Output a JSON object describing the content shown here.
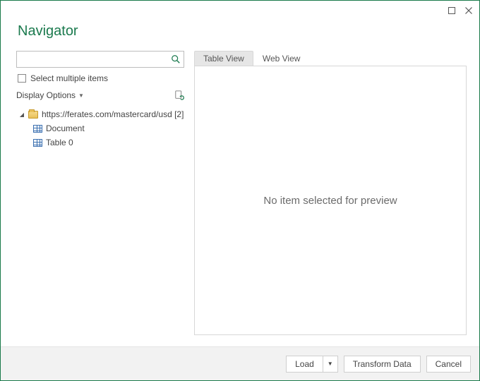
{
  "titlebar": {
    "maximize_icon": "maximize",
    "close_icon": "close"
  },
  "header": {
    "title": "Navigator"
  },
  "search": {
    "placeholder": ""
  },
  "checkbox": {
    "label": "Select multiple items"
  },
  "display_options": {
    "label": "Display Options"
  },
  "tree": {
    "root": {
      "label": "https://ferates.com/mastercard/usd [2]"
    },
    "items": [
      {
        "label": "Document"
      },
      {
        "label": "Table 0"
      }
    ]
  },
  "tabs": {
    "table_view": "Table View",
    "web_view": "Web View"
  },
  "preview": {
    "empty_text": "No item selected for preview"
  },
  "buttons": {
    "load": "Load",
    "transform": "Transform Data",
    "cancel": "Cancel"
  }
}
